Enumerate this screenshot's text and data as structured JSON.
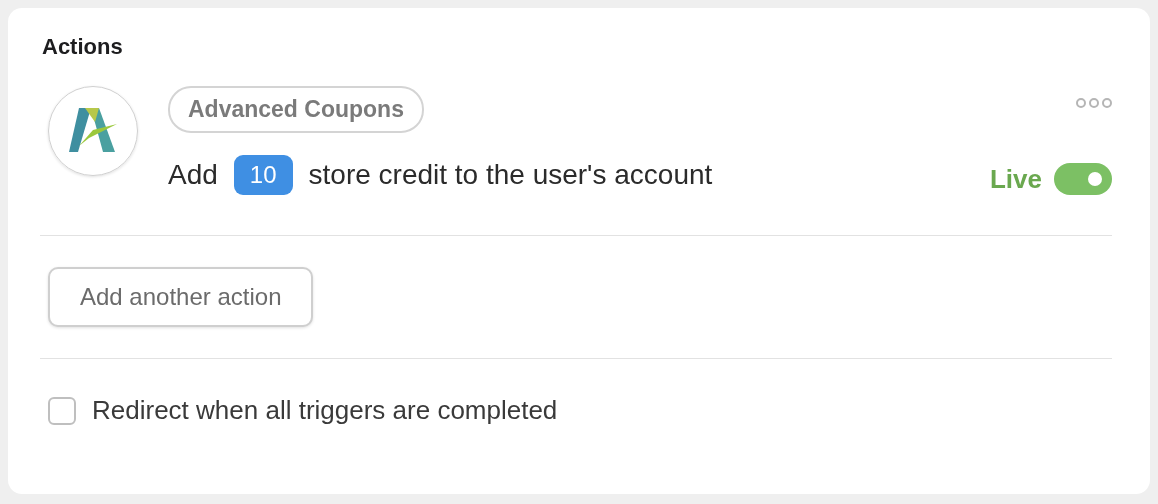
{
  "title": "Actions",
  "actions": [
    {
      "app": "Advanced Coupons",
      "text_before": "Add",
      "value": "10",
      "text_after": "store credit to the user's account",
      "status": "Live",
      "live": true
    }
  ],
  "add_button": "Add another action",
  "redirect": {
    "label": "Redirect when all triggers are completed",
    "checked": false
  }
}
